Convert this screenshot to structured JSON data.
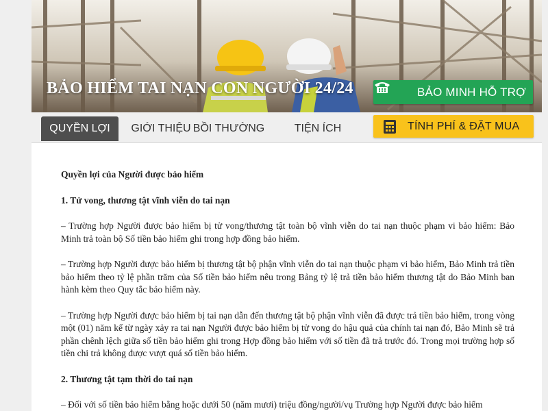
{
  "banner": {
    "title": "BẢO HIỂM TAI NẠN CON NGƯỜI 24/24",
    "support_button": "BẢO MINH HỖ TRỢ",
    "support_icon": "phone-icon"
  },
  "nav": {
    "tabs": [
      {
        "label": "QUYỀN LỢI",
        "active": true
      },
      {
        "label": "GIỚI THIỆU",
        "active": false
      },
      {
        "label": "BỒI THƯỜNG",
        "active": false
      },
      {
        "label": "TIỆN ÍCH",
        "active": false
      }
    ],
    "buy_button": "TÍNH PHÍ & ĐẶT MUA",
    "buy_icon": "calculator-icon"
  },
  "content": {
    "heading": "Quyền lợi của Người được bảo hiểm",
    "section1_title": "1. Tử vong, thương tật vĩnh viễn do tai nạn",
    "para1": "– Trường hợp Người được bảo hiểm bị tử vong/thương tật toàn bộ vĩnh viễn do tai nạn thuộc phạm vi bảo hiểm: Bảo Minh trả toàn bộ Số tiền bảo hiểm ghi trong hợp đồng bảo hiểm.",
    "para2": "– Trường hợp Người được bảo hiểm bị thương tật bộ phận vĩnh viễn do tai nạn thuộc phạm vi bảo hiểm, Bảo Minh trả tiền bảo hiểm theo tỷ lệ phần trăm của Số tiền bảo hiểm nêu trong Bảng tỷ lệ trả tiền bảo hiểm thương tật do Bảo Minh ban hành kèm theo Quy tắc bảo hiểm này.",
    "para3": "– Trường hợp Người được bảo hiểm bị tai nạn dẫn đến thương tật bộ phận vĩnh viễn đã được trả tiền bảo hiểm, trong vòng một (01) năm kể từ ngày xảy ra tai nạn Người được bảo hiểm bị tử vong do hậu quả của chính tai nạn đó, Bảo Minh sẽ trả phần chênh lệch giữa số tiền bảo hiểm ghi trong Hợp đồng bảo hiểm với số tiền đã trả trước đó. Trong mọi trường hợp số tiền chi trả không được vượt quá số tiền bảo hiểm.",
    "section2_title": "2. Thương tật tạm thời do tai nạn",
    "para4": "– Đối với số tiền bảo hiểm bằng hoặc dưới 50 (năm mươi) triệu đồng/người/vụ Trường hợp Người được bảo hiểm"
  },
  "colors": {
    "support_green": "#23a455",
    "buy_yellow": "#f9c21b",
    "active_tab": "#4e4e4e"
  }
}
